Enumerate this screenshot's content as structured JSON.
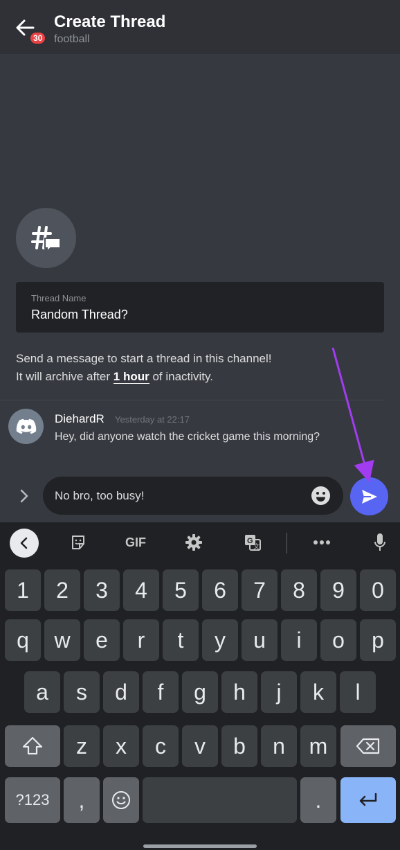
{
  "header": {
    "title": "Create Thread",
    "subtitle": "football",
    "badge_count": "30"
  },
  "thread_form": {
    "name_label": "Thread Name",
    "name_value": "Random Thread?",
    "info_line1": "Send a message to start a thread in this channel!",
    "info_line2_prefix": "It will archive after ",
    "info_line2_bold": "1 hour",
    "info_line2_suffix": " of inactivity."
  },
  "message": {
    "author": "DiehardR",
    "time": "Yesterday at 22:17",
    "text": "Hey, did anyone watch the cricket game this morning?"
  },
  "composer": {
    "input_value": "No bro, too busy!"
  },
  "keyboard": {
    "toolbar": [
      "chevron-left-icon",
      "sticker-icon",
      "GIF",
      "gear-icon",
      "translate-icon",
      "more-icon",
      "mic-icon"
    ],
    "gif_label": "GIF",
    "row_numbers": [
      "1",
      "2",
      "3",
      "4",
      "5",
      "6",
      "7",
      "8",
      "9",
      "0"
    ],
    "row_top": [
      "q",
      "w",
      "e",
      "r",
      "t",
      "y",
      "u",
      "i",
      "o",
      "p"
    ],
    "row_mid": [
      "a",
      "s",
      "d",
      "f",
      "g",
      "h",
      "j",
      "k",
      "l"
    ],
    "row_bottom": [
      "z",
      "x",
      "c",
      "v",
      "b",
      "n",
      "m"
    ],
    "symbols_label": "?123",
    "comma_label": ",",
    "period_label": "."
  },
  "colors": {
    "background": "#36393f",
    "header": "#2f3136",
    "accent": "#5865f2",
    "annotation_arrow": "#a13cf0",
    "badge": "#ed4245"
  }
}
